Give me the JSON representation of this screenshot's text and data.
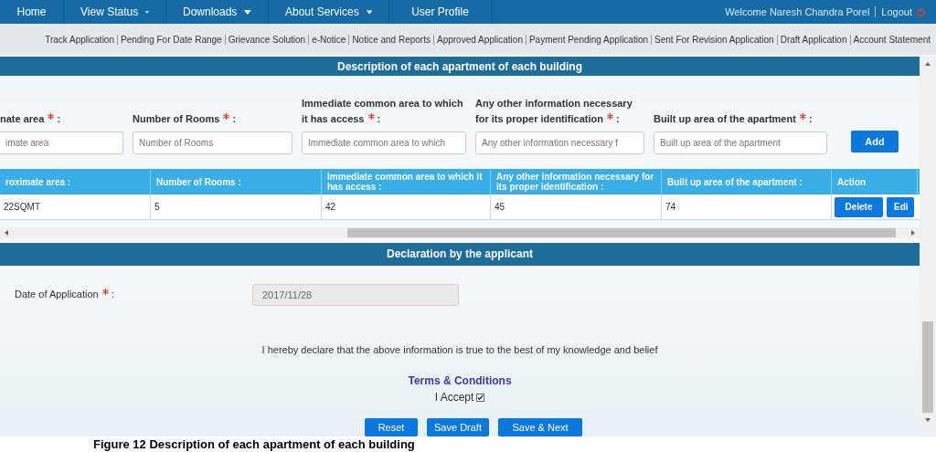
{
  "nav": {
    "items": [
      {
        "label": "Home",
        "dropdown": false
      },
      {
        "label": "View Status",
        "dropdown": true
      },
      {
        "label": "Downloads",
        "dropdown": true
      },
      {
        "label": "About Services",
        "dropdown": true
      },
      {
        "label": "User Profile",
        "dropdown": false
      }
    ],
    "welcome": "Welcome Naresh Chandra Porel",
    "logout": "Logout"
  },
  "subnav": [
    "Track Application",
    "Pending For Date Range",
    "Grievance Solution",
    "e-Notice",
    "Notice and Reports",
    "Approved Application",
    "Payment Pending Application",
    "Sent For Revision Application",
    "Draft Application",
    "Account Statement"
  ],
  "apartment_section": {
    "title": "Description of each apartment of each building",
    "fields": [
      {
        "label": "nate area",
        "required": true,
        "suffix": ":",
        "placeholder": "imate area"
      },
      {
        "label": "Number of Rooms",
        "required": true,
        "suffix": ":",
        "placeholder": "Number of Rooms"
      },
      {
        "label": "Immediate common area to which it has access",
        "required": true,
        "suffix": ":",
        "placeholder": "Immediate common area to which"
      },
      {
        "label": "Any other information necessary for its proper identification",
        "required": true,
        "suffix": ":",
        "placeholder": "Any other information necessary f"
      },
      {
        "label": "Built up area of the apartment",
        "required": true,
        "suffix": ":",
        "placeholder": "Built up area of the apartment"
      }
    ],
    "add_button": "Add"
  },
  "table": {
    "columns": [
      "roximate area :",
      "Number of Rooms :",
      "Immediate common area to which it has access :",
      "Any other information necessary for its proper identification :",
      "Built up area of the apartment :",
      "Action"
    ],
    "rows": [
      {
        "cells": [
          "22SQMT",
          "5",
          "42",
          "45",
          "74"
        ],
        "actions": [
          "Delete",
          "Edi"
        ]
      }
    ]
  },
  "declaration": {
    "title": "Declaration by the applicant",
    "date_label": "Date of Application",
    "date_required": true,
    "date_label_suffix": ":",
    "date_value": "2017/11/28",
    "statement": "I hereby declare that the above information is true to the best of my knowledge and belief",
    "terms_link": "Terms & Conditions",
    "accept_label": "I Accept",
    "accept_checked": true,
    "buttons": [
      "Reset",
      "Save Draft",
      "Save & Next"
    ]
  },
  "caption": "Figure 12 Description of each apartment of each building"
}
